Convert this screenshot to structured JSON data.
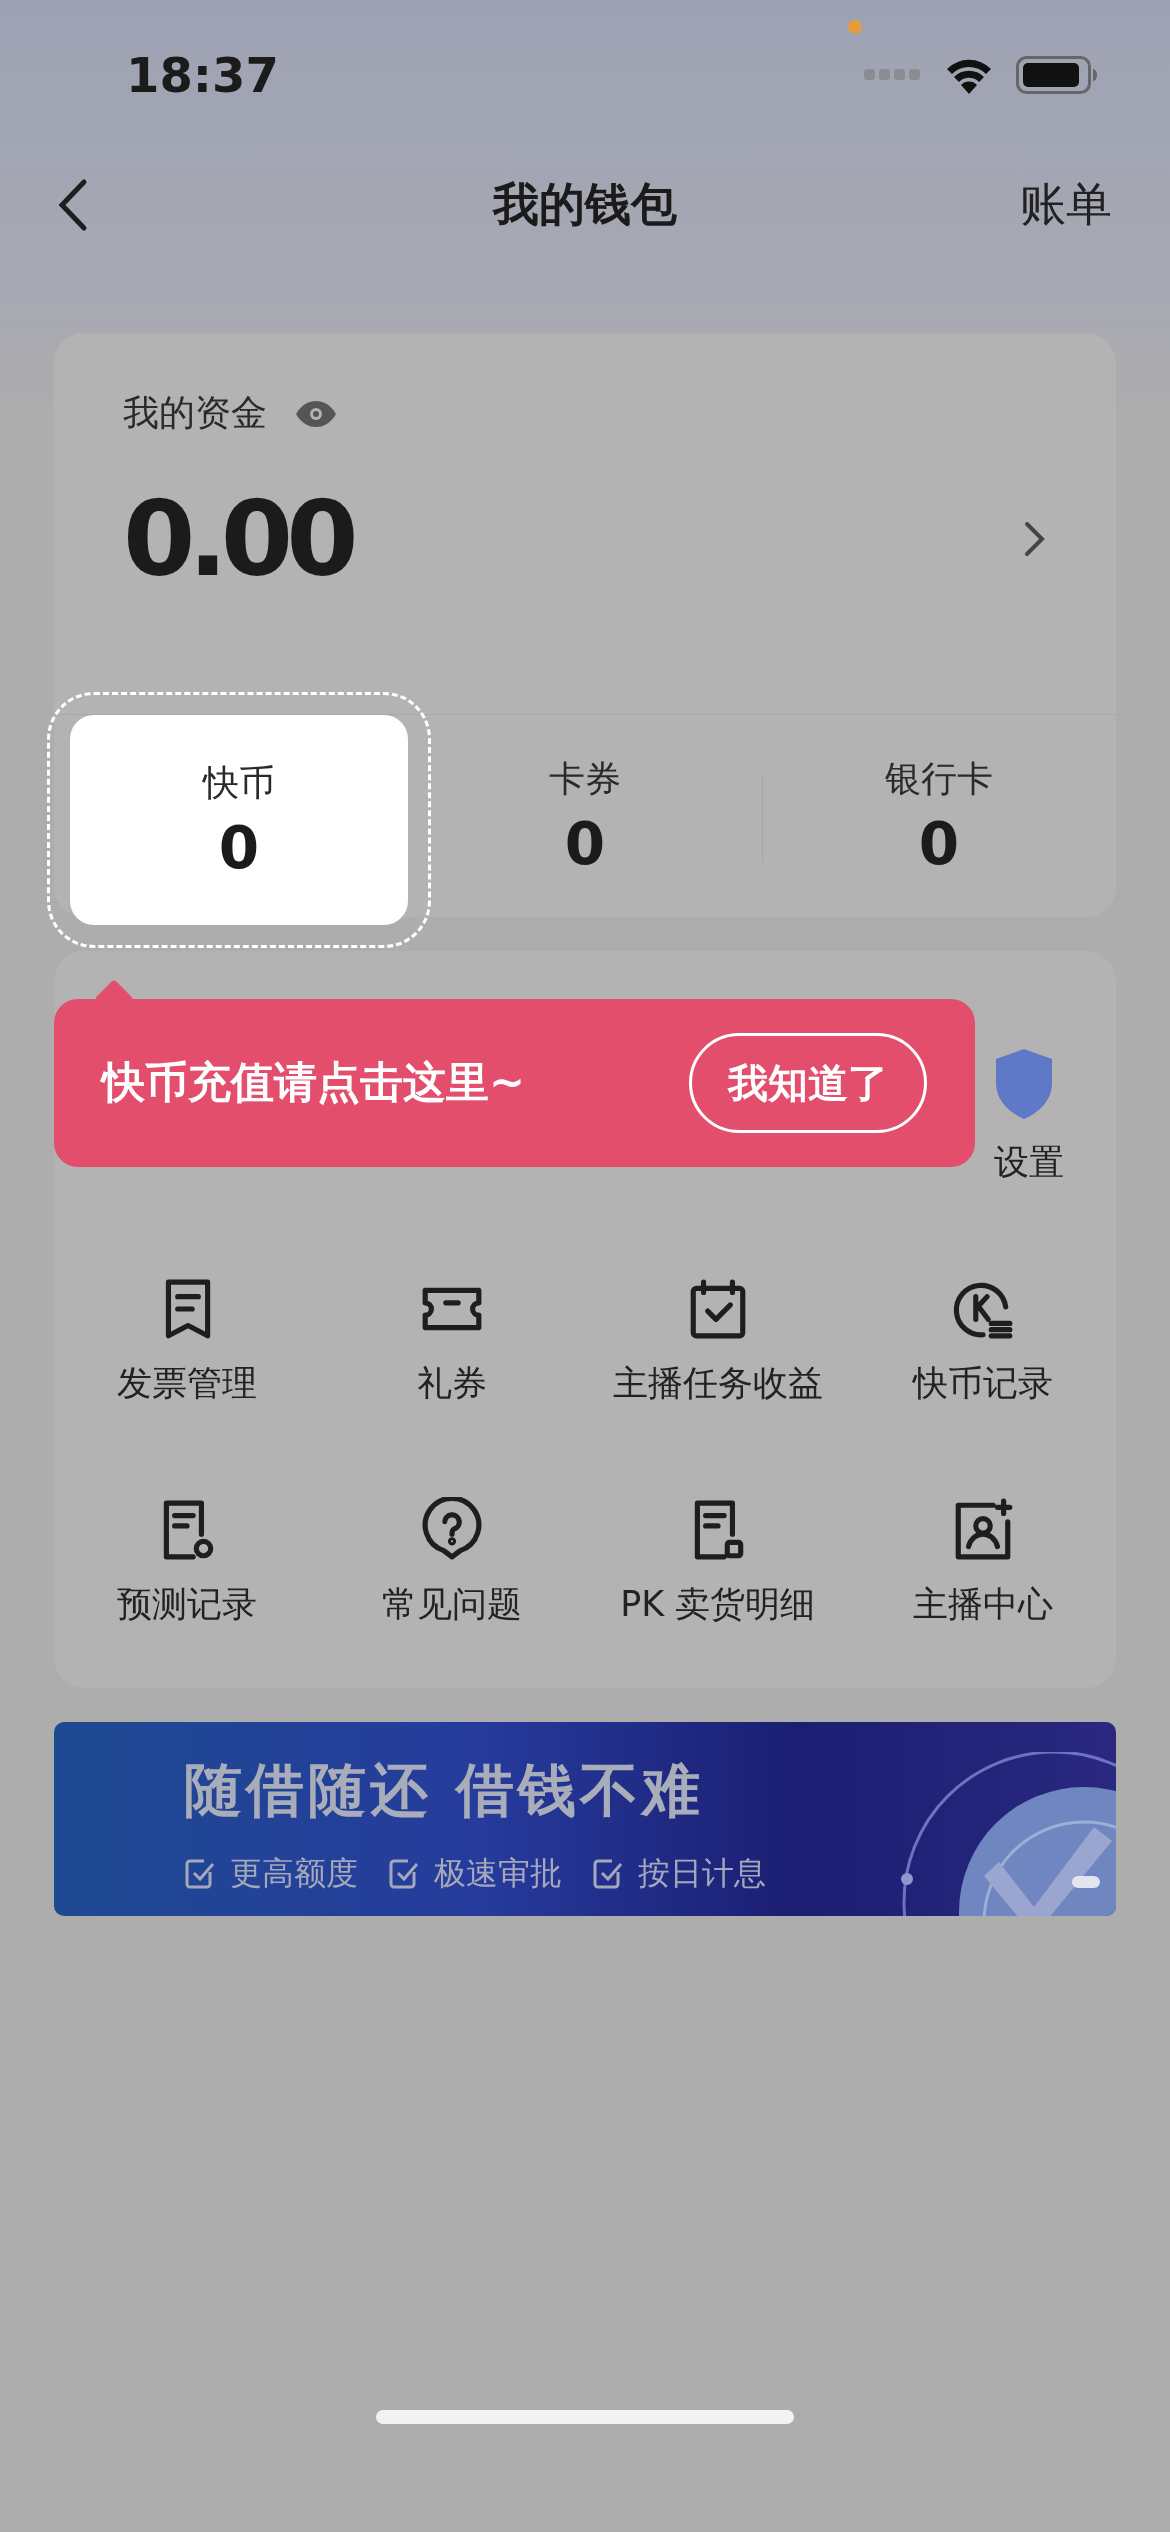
{
  "status_bar": {
    "time": "18:37"
  },
  "nav": {
    "title": "我的钱包",
    "action": "账单"
  },
  "funds": {
    "label": "我的资金",
    "amount": "0.00",
    "assets": [
      {
        "label": "快币",
        "value": "0",
        "highlighted": true
      },
      {
        "label": "卡券",
        "value": "0",
        "highlighted": false
      },
      {
        "label": "银行卡",
        "value": "0",
        "highlighted": false
      }
    ]
  },
  "tooltip": {
    "text": "快币充值请点击这里~",
    "button": "我知道了"
  },
  "menu": {
    "partial_label": "设置",
    "items": [
      {
        "label": "发票管理"
      },
      {
        "label": "礼券"
      },
      {
        "label": "主播任务收益"
      },
      {
        "label": "快币记录"
      },
      {
        "label": "预测记录"
      },
      {
        "label": "常见问题"
      },
      {
        "label": "PK 卖货明细"
      },
      {
        "label": "主播中心"
      }
    ]
  },
  "banner": {
    "headline": "随借随还 借钱不难",
    "features": [
      "更高额度",
      "极速审批",
      "按日计息"
    ]
  }
}
